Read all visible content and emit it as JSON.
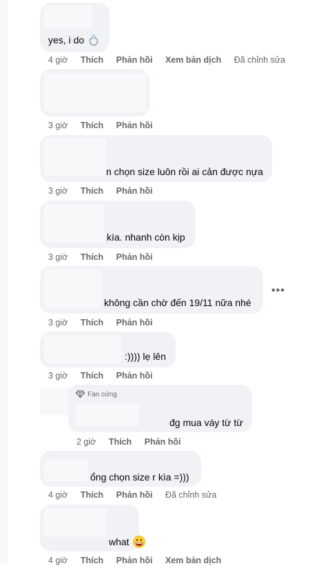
{
  "comments": [
    {
      "text": "yes, i do",
      "time": "4 giờ",
      "like": "Thích",
      "reply": "Phản hồi",
      "translate": "Xem bản dịch",
      "edited": "Đã chỉnh sửa"
    },
    {
      "text": "",
      "time": "3 giờ",
      "like": "Thích",
      "reply": "Phản hồi"
    },
    {
      "text": "n chọn size luôn rồi ai cản được nựa",
      "time": "3 giờ",
      "like": "Thích",
      "reply": "Phản hồi"
    },
    {
      "text": "kìa. nhanh còn kịp",
      "time": "3 giờ",
      "like": "Thích",
      "reply": "Phản hồi"
    },
    {
      "text": "không cần chờ đến 19/11 nữa nhé",
      "time": "3 giờ",
      "like": "Thích",
      "reply": "Phản hồi"
    },
    {
      "text": ":)))) lẹ lên",
      "time": "3 giờ",
      "like": "Thích",
      "reply": "Phản hồi"
    },
    {
      "badge": "Fan cứng",
      "text": "đg mua váy từ từ",
      "time": "2 giờ",
      "like": "Thích",
      "reply": "Phản hồi"
    },
    {
      "text": "ổng chọn size r kìa =)))",
      "time": "4 giờ",
      "like": "Thích",
      "reply": "Phản hồi",
      "edited": "Đã chỉnh sửa"
    },
    {
      "text": "what",
      "time": "4 giờ",
      "like": "Thích",
      "reply": "Phản hồi",
      "translate": "Xem bản dịch"
    }
  ],
  "icons": {
    "ring": "ring-emoji-icon",
    "grin": "grinning-emoji-icon",
    "more": "more-options-icon",
    "badge": "diamond-badge-icon"
  }
}
